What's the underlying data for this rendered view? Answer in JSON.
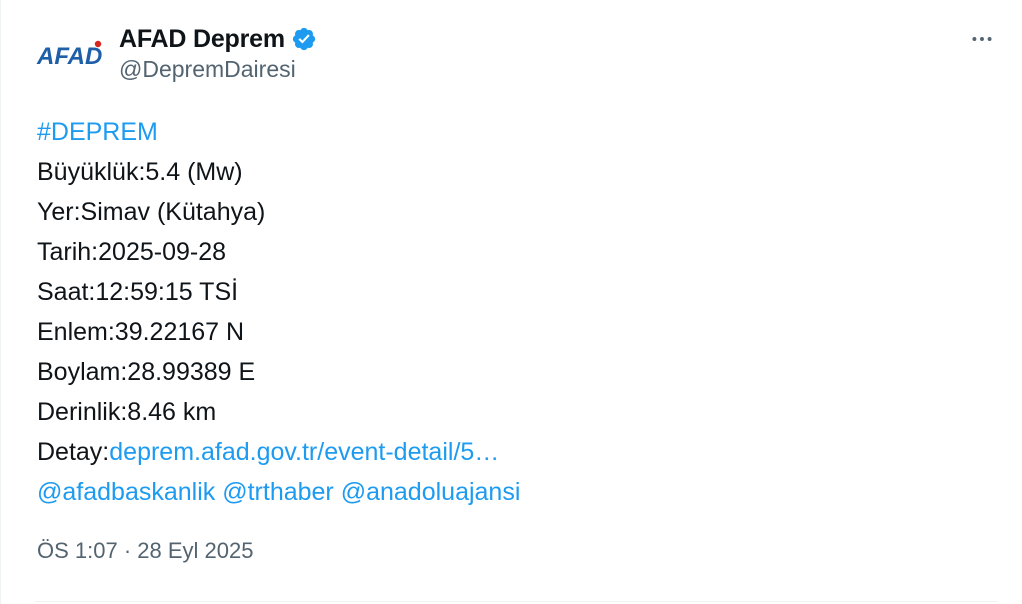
{
  "author": {
    "avatar_text": "AFAD",
    "display_name": "AFAD Deprem",
    "handle": "@DepremDairesi",
    "verified": true
  },
  "menu": {
    "icon": "more-horizontal-icon"
  },
  "tweet": {
    "hashtag": "#DEPREM",
    "lines": {
      "magnitude": "Büyüklük:5.4 (Mw)",
      "location": "Yer:Simav (Kütahya)",
      "date": "Tarih:2025-09-28",
      "time": "Saat:12:59:15 TSİ",
      "latitude": "Enlem:39.22167 N",
      "longitude": "Boylam:28.99389 E",
      "depth": "Derinlik:8.46 km"
    },
    "detail_label": "Detay:",
    "detail_link": "deprem.afad.gov.tr/event-detail/5…",
    "mentions": [
      "@afadbaskanlik",
      "@trthaber",
      "@anadoluajansi"
    ]
  },
  "timestamp": "ÖS 1:07 · 28 Eyl 2025",
  "colors": {
    "link": "#1d9bf0",
    "verified": "#1d9bf0",
    "brand_blue": "#1f5fa8",
    "brand_red": "#d7261e",
    "secondary_text": "#536471"
  }
}
